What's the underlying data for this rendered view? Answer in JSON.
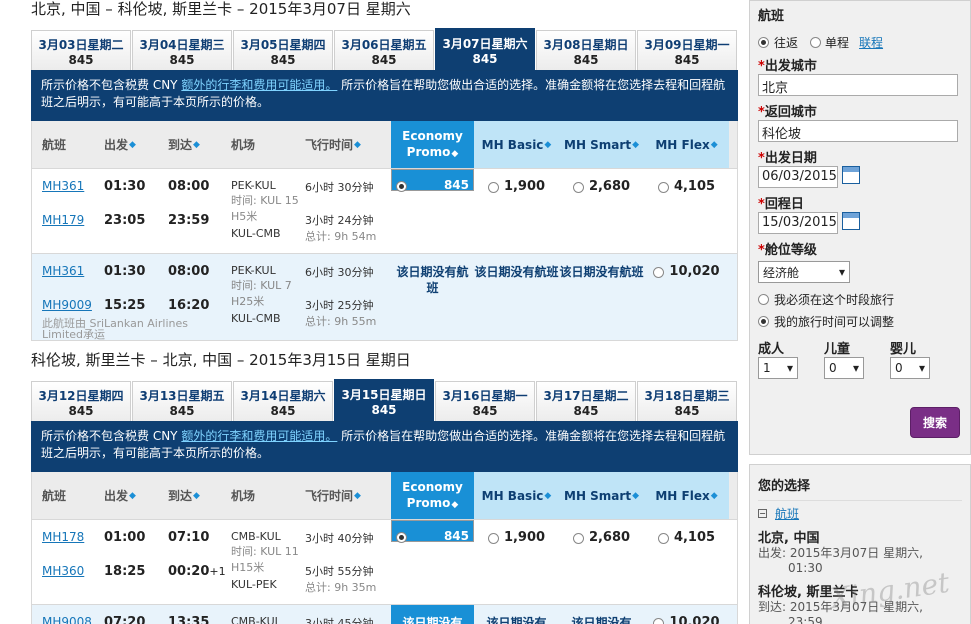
{
  "out": {
    "title": "北京, 中国 – 科伦坡, 斯里兰卡 – 2015年3月07日 星期六",
    "tabs": [
      {
        "d": "3月03日星期二",
        "p": "845"
      },
      {
        "d": "3月04日星期三",
        "p": "845"
      },
      {
        "d": "3月05日星期四",
        "p": "845"
      },
      {
        "d": "3月06日星期五",
        "p": "845"
      },
      {
        "d": "3月07日星期六",
        "p": "845"
      },
      {
        "d": "3月08日星期日",
        "p": "845"
      },
      {
        "d": "3月09日星期一",
        "p": "845"
      }
    ],
    "flights": [
      {
        "a_no": "MH361",
        "a_dep": "01:30",
        "a_arr": "08:00",
        "a_ap": "PEK-KUL",
        "a_dur": "6小时 30分钟",
        "lay": "时间: KUL 15 H5米",
        "b_no": "MH179",
        "b_dep": "23:05",
        "b_arr": "23:59",
        "b_ap": "KUL-CMB",
        "b_dur": "3小时 24分钟",
        "total": "总计: 9h 54m",
        "eco": "845",
        "basic": "1,900",
        "smart": "2,680",
        "flex": "4,105"
      },
      {
        "a_no": "MH361",
        "a_dep": "01:30",
        "a_arr": "08:00",
        "a_ap": "PEK-KUL",
        "a_dur": "6小时 30分钟",
        "lay": "时间: KUL 7 H25米",
        "b_no": "MH9009",
        "b_dep": "15:25",
        "b_arr": "16:20",
        "b_ap": "KUL-CMB",
        "b_dur": "3小时 25分钟",
        "total": "总计: 9h 55m",
        "op": "此航班由 SriLankan Airlines Limited承运",
        "noflight": "该日期没有航班",
        "flex": "10,020"
      }
    ]
  },
  "ret": {
    "title": "科伦坡, 斯里兰卡 – 北京, 中国 – 2015年3月15日 星期日",
    "tabs": [
      {
        "d": "3月12日星期四",
        "p": "845"
      },
      {
        "d": "3月13日星期五",
        "p": "845"
      },
      {
        "d": "3月14日星期六",
        "p": "845"
      },
      {
        "d": "3月15日星期日",
        "p": "845"
      },
      {
        "d": "3月16日星期一",
        "p": "845"
      },
      {
        "d": "3月17日星期二",
        "p": "845"
      },
      {
        "d": "3月18日星期三",
        "p": "845"
      }
    ],
    "flights": [
      {
        "a_no": "MH178",
        "a_dep": "01:00",
        "a_arr": "07:10",
        "a_ap": "CMB-KUL",
        "a_dur": "3小时 40分钟",
        "lay": "时间: KUL 11 H15米",
        "b_no": "MH360",
        "b_dep": "18:25",
        "b_arr": "00:20",
        "b_plus": "+1",
        "b_ap": "KUL-PEK",
        "b_dur": "5小时 55分钟",
        "total": "总计: 9h 35m",
        "eco": "845",
        "basic": "1,900",
        "smart": "2,680",
        "flex": "4,105"
      },
      {
        "a_no": "MH9008",
        "a_dep": "07:20",
        "a_arr": "13:35",
        "a_ap": "CMB-KUL",
        "a_dur": "3小时 45分钟",
        "noflight": "该日期没有",
        "flex": "10,020"
      }
    ]
  },
  "notice": {
    "pre": "所示价格不包含税费 CNY ",
    "link": "额外的行李和费用可能适用。",
    "post": " 所示价格旨在帮助您做出合适的选择。准确金额将在您选择去程和回程航班之后明示，有可能高于本页所示的价格。"
  },
  "cols": {
    "flight": "航班",
    "dep": "出发",
    "arr": "到达",
    "airport": "机场",
    "dur": "飞行时间",
    "eco1": "Economy",
    "eco2": "Promo",
    "basic": "MH Basic",
    "smart": "MH Smart",
    "flex": "MH Flex"
  },
  "side": {
    "title": "航班",
    "round": "往返",
    "oneway": "单程",
    "multi": "联程",
    "from_l": "出发城市",
    "from": "北京",
    "to_l": "返回城市",
    "to": "科伦坡",
    "dep_l": "出发日期",
    "dep": "06/03/2015",
    "ret_l": "回程日",
    "ret": "15/03/2015",
    "cls_l": "舱位等级",
    "cls": "经济舱",
    "opt1": "我必须在这个时段旅行",
    "opt2": "我的旅行时间可以调整",
    "adult": "成人",
    "child": "儿童",
    "inf": "婴儿",
    "a": "1",
    "c": "0",
    "i": "0",
    "search": "搜索"
  },
  "choice": {
    "title": "您的选择",
    "sec": "航班",
    "c1": "北京, 中国",
    "c1d": "出发: 2015年3月07日 星期六,",
    "c1t": "01:30",
    "c2": "科伦坡, 斯里兰卡",
    "c2d": "到达: 2015年3月07日 星期六,",
    "c2t": "23:59"
  },
  "wm": "Xing.net"
}
